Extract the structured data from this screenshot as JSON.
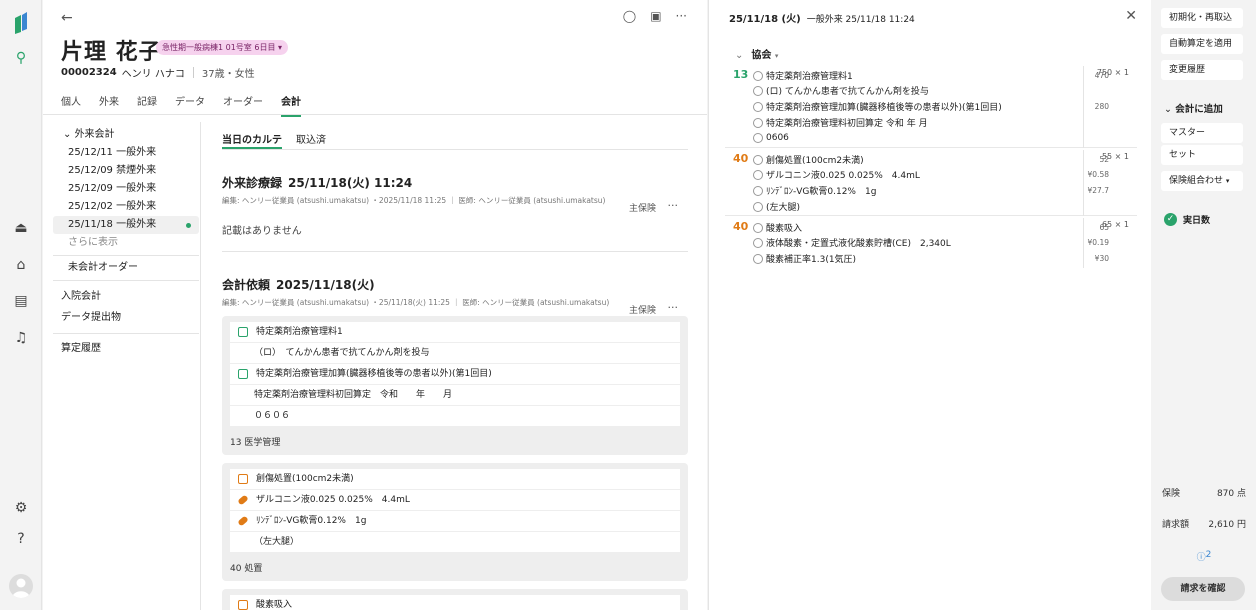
{
  "colors": {
    "accent": "#2aa36b",
    "orange": "#e07b16",
    "badge_bg": "#f6d2ee",
    "badge_fg": "#7a2567"
  },
  "rail": {
    "icons": [
      "logo-icon",
      "patient-search-icon",
      "eject-icon",
      "bed-icon",
      "list-icon",
      "bell-icon",
      "gear-icon",
      "help-icon",
      "avatar-icon"
    ]
  },
  "patient": {
    "name": "片理 花子",
    "ward_badge": "急性期一般病棟1 01号室 6日目",
    "id": "00002324",
    "kana": "ヘンリ ハナコ",
    "age_sex": "37歳・女性"
  },
  "patient_tabs": [
    "個人",
    "外来",
    "記録",
    "データ",
    "オーダー",
    "会計"
  ],
  "active_patient_tab": "会計",
  "left_nav": {
    "group": "外来会計",
    "visits": [
      "25/12/11 一般外来",
      "25/12/09 禁煙外来",
      "25/12/09 一般外来",
      "25/12/02 一般外来",
      "25/11/18 一般外来"
    ],
    "show_more": "さらに表示",
    "unbilled": "未会計オーダー",
    "links": [
      "入院会計",
      "データ提出物",
      "算定履歴"
    ]
  },
  "content_tabs": [
    "当日のカルテ",
    "取込済"
  ],
  "record": {
    "title": "外来診療録",
    "datetime": "25/11/18(火) 11:24",
    "insurance": "主保険",
    "meta": "編集: ヘンリー従業員 (atsushi.umakatsu) ・2025/11/18 11:25 ｜ 医師: ヘンリー従業員 (atsushi.umakatsu)",
    "empty": "記載はありません"
  },
  "request": {
    "title": "会計依頼",
    "datetime": "2025/11/18(火)",
    "insurance": "主保険",
    "meta": "編集: ヘンリー従業員 (atsushi.umakatsu) ・25/11/18(火) 11:25 ｜ 医師: ヘンリー従業員 (atsushi.umakatsu)"
  },
  "card1": {
    "rows": [
      "特定薬剤治療管理料1",
      "（ロ）　てんかん患者で抗てんかん剤を投与",
      "特定薬剤治療管理加算(臓器移植後等の患者以外)(第1回目)",
      "特定薬剤治療管理料初回算定　令和　　年　　月",
      "０６０６"
    ],
    "footer": "13 医学管理"
  },
  "card2": {
    "rows": [
      "創傷処置(100cm2未満)",
      "ザルコニン液0.025 0.025%　4.4mL",
      "ﾘﾝﾃﾞﾛﾝ-VG軟膏0.12%　1g",
      "（左大腿）"
    ],
    "footer": "40 処置"
  },
  "card3": {
    "rows": [
      "酸素吸入"
    ]
  },
  "detail": {
    "date": "25/11/18 (火)",
    "visit": "一般外来 25/11/18 11:24",
    "group": "協会",
    "groups": [
      {
        "points": "13",
        "total": "750 × 1",
        "lines": [
          {
            "t": "特定薬剤治療管理料1",
            "a": "470"
          },
          {
            "t": "(ロ) てんかん患者で抗てんかん剤を投与",
            "a": ""
          },
          {
            "t": "特定薬剤治療管理加算(臓器移植後等の患者以外)(第1回目)",
            "a": "280"
          },
          {
            "t": "特定薬剤治療管理料初回算定 令和 年 月",
            "a": ""
          },
          {
            "t": "0606",
            "a": ""
          }
        ]
      },
      {
        "points": "40",
        "total": "55 × 1",
        "lines": [
          {
            "t": "創傷処置(100cm2未満)",
            "a": "52"
          },
          {
            "t": "ザルコニン液0.025 0.025%　4.4mL",
            "a": "¥0.58"
          },
          {
            "t": "ﾘﾝﾃﾞﾛﾝ-VG軟膏0.12%　1g",
            "a": "¥27.7"
          },
          {
            "t": "(左大腿)",
            "a": ""
          }
        ]
      },
      {
        "points": "40",
        "total": "65 × 1",
        "lines": [
          {
            "t": "酸素吸入",
            "a": "65"
          },
          {
            "t": "液体酸素・定置式液化酸素貯槽(CE)　2,340L",
            "a": "¥0.19"
          },
          {
            "t": "酸素補正率1.3(1気圧)",
            "a": "¥30"
          }
        ]
      }
    ]
  },
  "actions": {
    "reset": "初期化・再取込",
    "auto": "自動算定を適用",
    "history": "変更履歴",
    "add_label": "会計に追加",
    "master": "マスター",
    "set": "セット",
    "insurance_combo": "保険組合わせ",
    "days": "実日数",
    "ins_label": "保険",
    "ins_value": "870 点",
    "bill_label": "請求額",
    "bill_value": "2,610 円",
    "info_count": "2",
    "confirm": "請求を確認"
  }
}
